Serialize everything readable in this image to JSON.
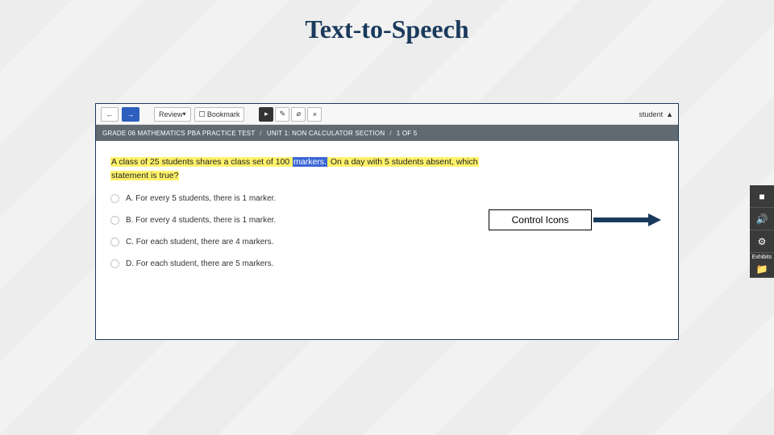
{
  "title": "Text-to-Speech",
  "toolbar": {
    "back_glyph": "←",
    "fwd_glyph": "→",
    "review_label": "Review",
    "bookmark_label": "Bookmark",
    "pointer_glyph": "▸",
    "note_glyph": "✎",
    "eraser_glyph": "⌀",
    "close_glyph": "×",
    "user_label": "student"
  },
  "crumbs": {
    "a": "GRADE 06 MATHEMATICS PBA PRACTICE TEST",
    "b": "UNIT 1: NON CALCULATOR SECTION",
    "c": "1 OF 5"
  },
  "question": {
    "pre": "A class of 25 students shares a class set of 100 ",
    "word_sel": "markers.",
    "mid": " On a day with 5 students absent, which",
    "line2": "statement is true?",
    "opts": {
      "a": "A.   For every 5 students, there is 1 marker.",
      "b": "B.   For every 4 students, there is 1 marker.",
      "c": "C.   For each student, there are 4 markers.",
      "d": "D.   For each student, there are 5 markers."
    }
  },
  "side": {
    "stop_glyph": "■",
    "speaker_glyph": "🔊",
    "gear_glyph": "⚙",
    "exhibits_label": "Exhibits",
    "folder_glyph": "📁"
  },
  "callout": "Control Icons"
}
